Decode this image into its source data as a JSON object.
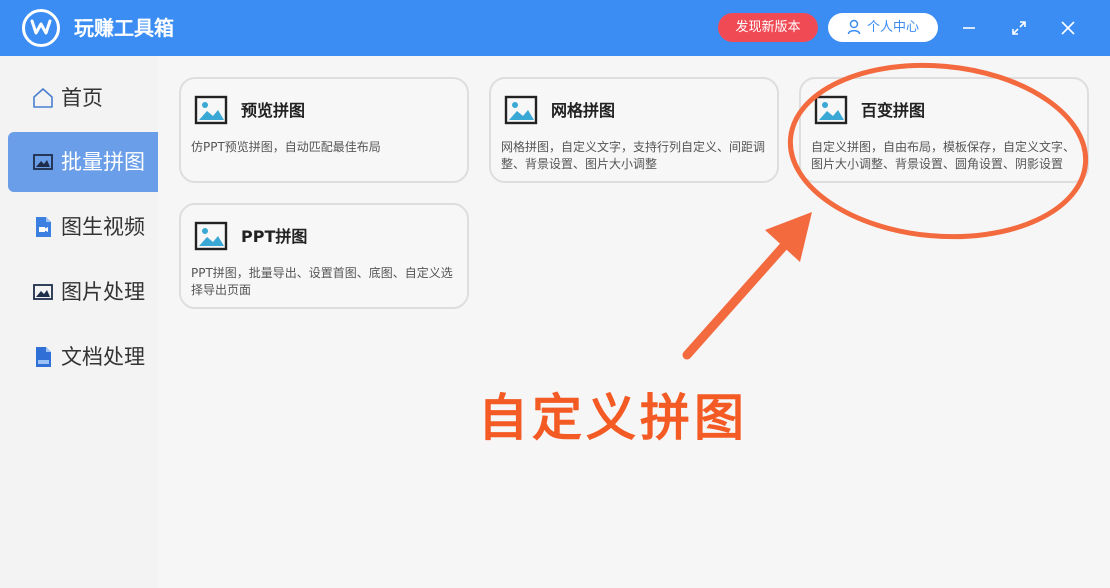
{
  "app": {
    "title": "玩赚工具箱"
  },
  "header": {
    "new_version_label": "发现新版本",
    "user_center_label": "个人中心",
    "icons": [
      "logo-icon",
      "user-icon",
      "minimize-icon",
      "maximize-icon",
      "close-icon"
    ]
  },
  "sidebar": {
    "items": [
      {
        "label": "首页",
        "icon": "home-icon",
        "active": false
      },
      {
        "label": "批量拼图",
        "icon": "image-icon",
        "active": true
      },
      {
        "label": "图生视频",
        "icon": "video-file-icon",
        "active": false
      },
      {
        "label": "图片处理",
        "icon": "image-icon",
        "active": false
      },
      {
        "label": "文档处理",
        "icon": "doc-file-icon",
        "active": false
      }
    ]
  },
  "main": {
    "cards": [
      {
        "title": "预览拼图",
        "desc": "仿PPT预览拼图，自动匹配最佳布局",
        "icon": "picture-icon"
      },
      {
        "title": "网格拼图",
        "desc": "网格拼图，自定义文字，支持行列自定义、间距调整、背景设置、图片大小调整",
        "icon": "picture-icon"
      },
      {
        "title": "百变拼图",
        "desc": "自定义拼图，自由布局，模板保存，自定义文字、图片大小调整、背景设置、圆角设置、阴影设置",
        "icon": "picture-icon"
      },
      {
        "title": "PPT拼图",
        "desc": "PPT拼图，批量导出、设置首图、底图、自定义选择导出页面",
        "icon": "picture-icon"
      }
    ]
  },
  "annotation": {
    "text": "自定义拼图",
    "color": "#f45a23"
  },
  "colors": {
    "header_bg": "#3b8df3",
    "new_version_bg": "#f04a55",
    "sidebar_active_bg": "#6b9ee8"
  }
}
